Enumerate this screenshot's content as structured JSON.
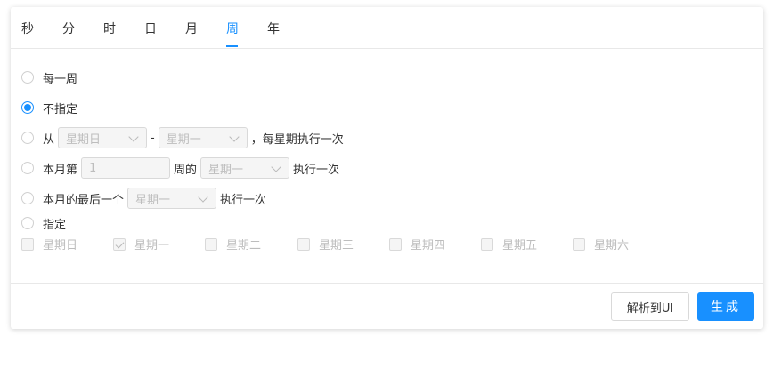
{
  "tabs": [
    {
      "label": "秒"
    },
    {
      "label": "分"
    },
    {
      "label": "时"
    },
    {
      "label": "日"
    },
    {
      "label": "月"
    },
    {
      "label": "周",
      "active": true
    },
    {
      "label": "年"
    }
  ],
  "options": {
    "every_week": "每一周",
    "unspecified": "不指定",
    "range": {
      "from_label": "从",
      "start_select": "星期日",
      "separator": "-",
      "end_select": "星期一",
      "suffix": "，每星期执行一次"
    },
    "nth_week": {
      "prefix": "本月第",
      "input_value": "1",
      "middle": "周的",
      "select": "星期一",
      "suffix": "执行一次"
    },
    "last_week": {
      "prefix": "本月的最后一个",
      "select": "星期一",
      "suffix": "执行一次"
    },
    "specify": "指定",
    "days": [
      {
        "label": "星期日",
        "checked": false
      },
      {
        "label": "星期一",
        "checked": true
      },
      {
        "label": "星期二",
        "checked": false
      },
      {
        "label": "星期三",
        "checked": false
      },
      {
        "label": "星期四",
        "checked": false
      },
      {
        "label": "星期五",
        "checked": false
      },
      {
        "label": "星期六",
        "checked": false
      }
    ]
  },
  "selected_option": "unspecified",
  "footer": {
    "parse_button": "解析到UI",
    "generate_button": "生成"
  },
  "colors": {
    "accent": "#1890ff",
    "disabled_text": "#bdbdbd",
    "border": "#d9d9d9"
  }
}
